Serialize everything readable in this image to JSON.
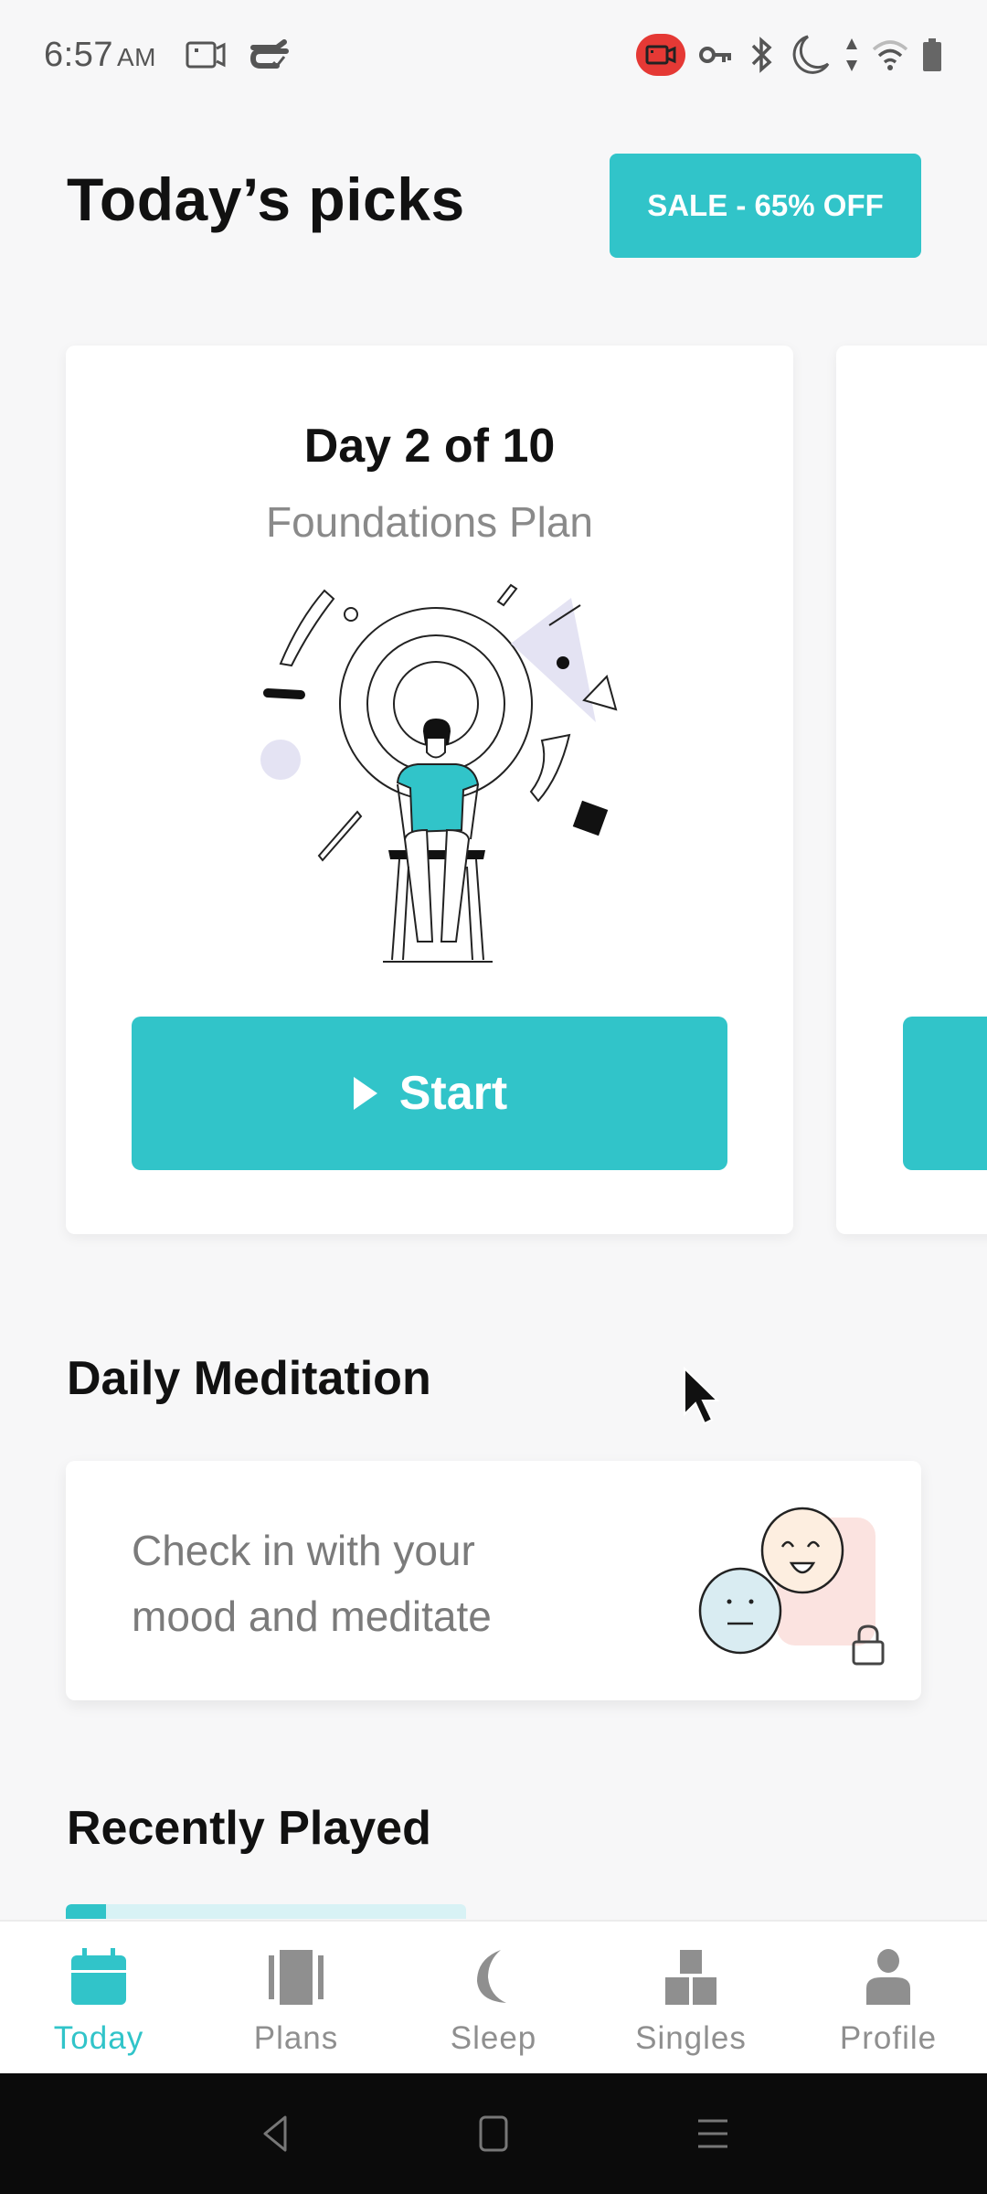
{
  "status_bar": {
    "time": "6:57",
    "ampm": "AM",
    "left_icons": [
      "screen-record-icon",
      "sync-icon"
    ],
    "right_icons": [
      "recording-icon",
      "vpn-key-icon",
      "bluetooth-icon",
      "do-not-disturb-icon",
      "data-arrows-icon",
      "wifi-icon",
      "battery-icon"
    ]
  },
  "header": {
    "title": "Today’s picks",
    "sale_label": "SALE - 65% OFF"
  },
  "picks": [
    {
      "day_label": "Day 2 of 10",
      "plan_name": "Foundations Plan",
      "button_label": "Start"
    }
  ],
  "daily_meditation": {
    "title": "Daily Meditation",
    "text": "Check in with your mood and meditate",
    "locked": true
  },
  "recently_played": {
    "title": "Recently Played",
    "progress_percent": 10
  },
  "bottom_nav": {
    "items": [
      {
        "label": "Today",
        "icon": "calendar-icon",
        "active": true
      },
      {
        "label": "Plans",
        "icon": "plans-icon",
        "active": false
      },
      {
        "label": "Sleep",
        "icon": "moon-icon",
        "active": false
      },
      {
        "label": "Singles",
        "icon": "blocks-icon",
        "active": false
      },
      {
        "label": "Profile",
        "icon": "person-icon",
        "active": false
      }
    ]
  },
  "colors": {
    "accent": "#31c4c9",
    "background": "#f7f7f8",
    "inactive": "#8f8f8f"
  }
}
